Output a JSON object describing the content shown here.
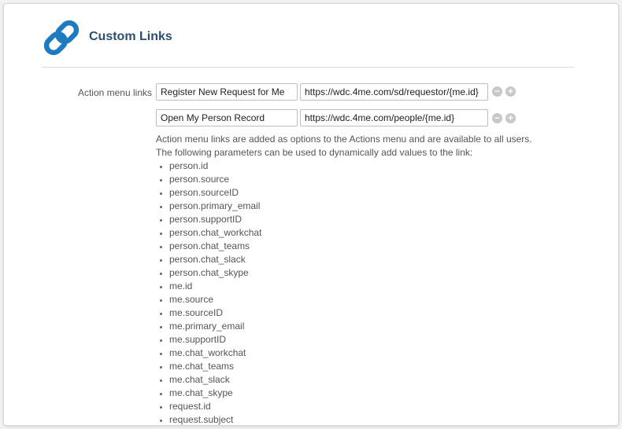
{
  "header": {
    "title": "Custom Links",
    "icon": "link-icon",
    "icon_color": "#1f7bbf"
  },
  "form": {
    "label": "Action menu links",
    "links": [
      {
        "name": "Register New Request for Me",
        "url": "https://wdc.4me.com/sd/requestor/{me.id}"
      },
      {
        "name": "Open My Person Record",
        "url": "https://wdc.4me.com/people/{me.id}"
      }
    ],
    "remove_glyph": "−",
    "add_glyph": "+"
  },
  "help": {
    "line1": "Action menu links are added as options to the Actions menu and are available to all users.",
    "line2": "The following parameters can be used to dynamically add values to the link:",
    "parameters": [
      "person.id",
      "person.source",
      "person.sourceID",
      "person.primary_email",
      "person.supportID",
      "person.chat_workchat",
      "person.chat_teams",
      "person.chat_slack",
      "person.chat_skype",
      "me.id",
      "me.source",
      "me.sourceID",
      "me.primary_email",
      "me.supportID",
      "me.chat_workchat",
      "me.chat_teams",
      "me.chat_slack",
      "me.chat_skype",
      "request.id",
      "request.subject"
    ]
  }
}
